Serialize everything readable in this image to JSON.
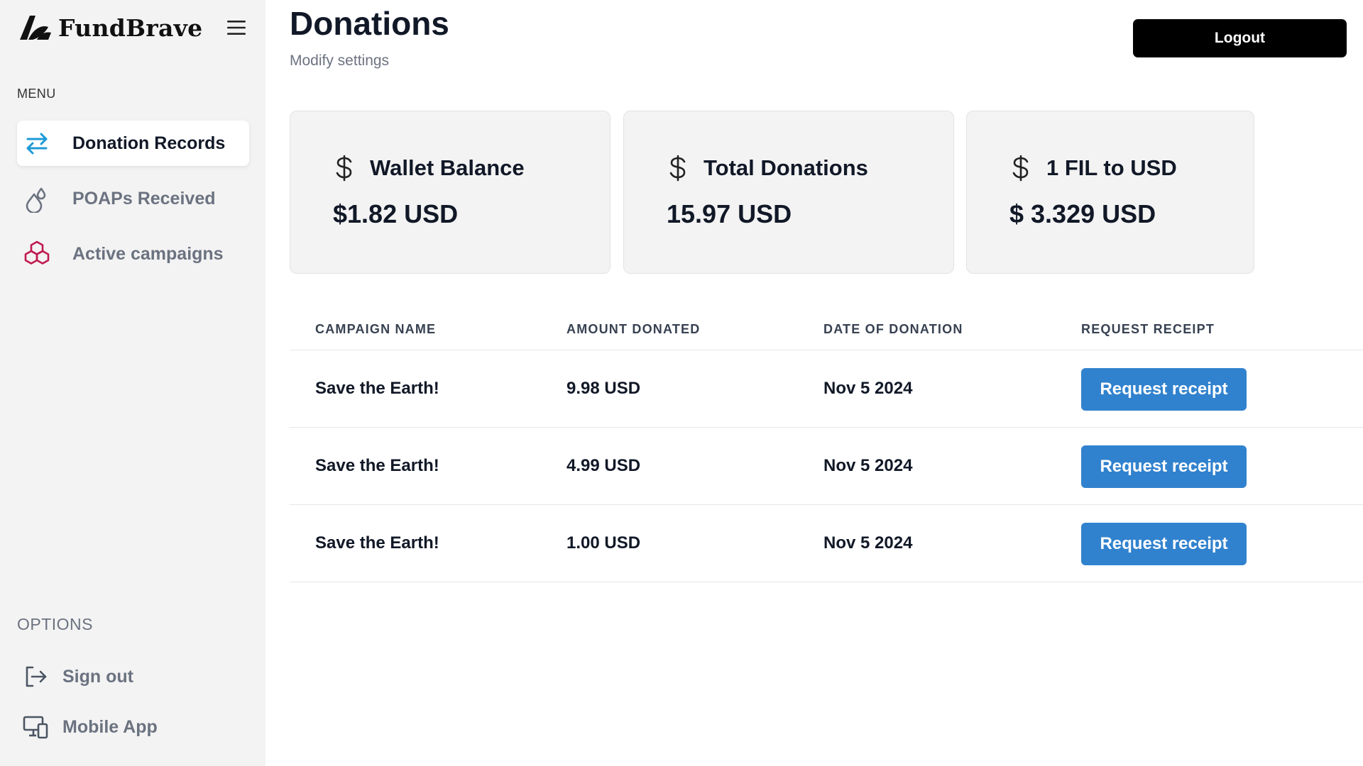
{
  "brand": {
    "name": "FundBrave"
  },
  "sidebar": {
    "menu_label": "MENU",
    "items": [
      {
        "label": "Donation Records",
        "icon": "arrows-exchange-icon",
        "active": true
      },
      {
        "label": "POAPs Received",
        "icon": "droplets-icon",
        "active": false
      },
      {
        "label": "Active campaigns",
        "icon": "cubes-icon",
        "active": false
      }
    ],
    "options_label": "OPTIONS",
    "options": [
      {
        "label": "Sign out",
        "icon": "sign-out-icon"
      },
      {
        "label": "Mobile App",
        "icon": "devices-icon"
      }
    ]
  },
  "header": {
    "title": "Donations",
    "subtitle": "Modify settings",
    "logout_label": "Logout"
  },
  "cards": [
    {
      "title": "Wallet Balance",
      "value": "$1.82 USD",
      "icon": "dollar-icon"
    },
    {
      "title": "Total Donations",
      "value": "15.97 USD",
      "icon": "dollar-icon"
    },
    {
      "title": "1 FIL to USD",
      "value": "$ 3.329 USD",
      "icon": "dollar-icon"
    }
  ],
  "table": {
    "headers": [
      "CAMPAIGN NAME",
      "AMOUNT DONATED",
      "DATE OF DONATION",
      "REQUEST RECEIPT"
    ],
    "rows": [
      {
        "campaign": "Save the Earth!",
        "amount": "9.98 USD",
        "date": "Nov 5 2024",
        "action": "Request receipt"
      },
      {
        "campaign": "Save the Earth!",
        "amount": "4.99 USD",
        "date": "Nov 5 2024",
        "action": "Request receipt"
      },
      {
        "campaign": "Save the Earth!",
        "amount": "1.00 USD",
        "date": "Nov 5 2024",
        "action": "Request receipt"
      }
    ]
  },
  "colors": {
    "sidebar_bg": "#f3f3f3",
    "accent_blue": "#3182ce",
    "icon_blue": "#1e9ad6",
    "icon_pink": "#c0194f",
    "logout_bg": "#000000"
  }
}
